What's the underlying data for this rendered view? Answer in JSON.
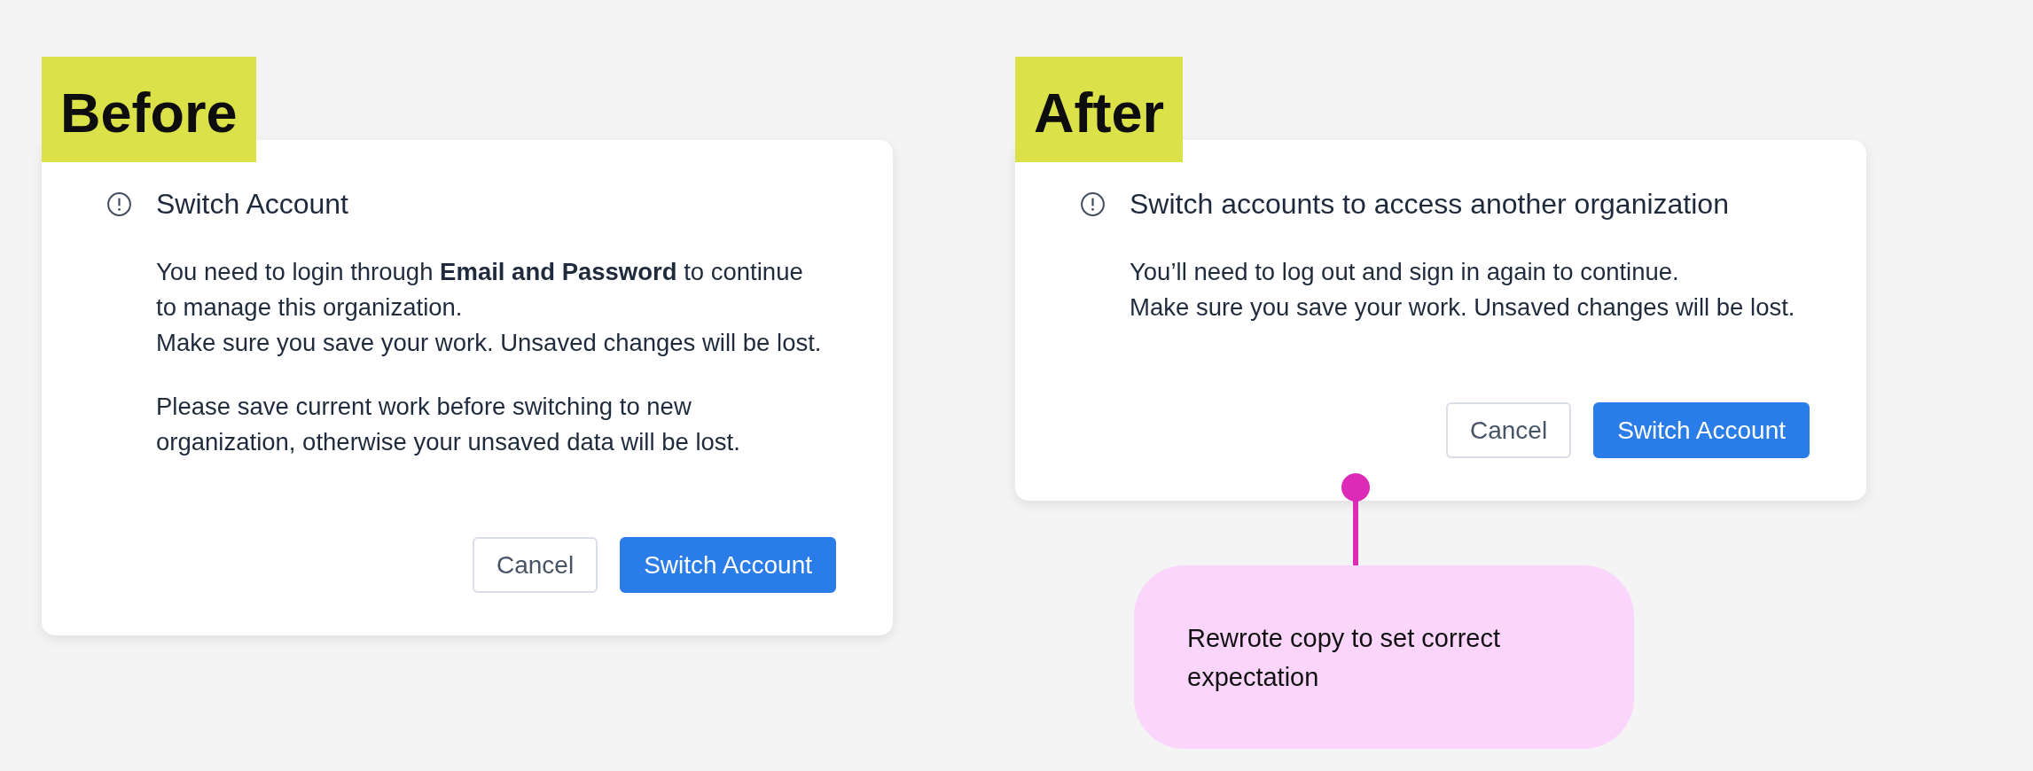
{
  "panels": [
    {
      "label": "Before",
      "dialog": {
        "title": "Switch Account",
        "paragraphs": [
          {
            "lines": [
              "You need to login through **Email and Password** to continue",
              "to manage this organization.",
              "Make sure you save your work. Unsaved changes will be lost."
            ]
          },
          {
            "lines": [
              "Please save current work before switching to new",
              "organization, otherwise your unsaved data will be lost."
            ]
          }
        ],
        "buttons": [
          {
            "label": "Cancel",
            "kind": "secondary"
          },
          {
            "label": "Switch Account",
            "kind": "primary"
          }
        ]
      }
    },
    {
      "label": "After",
      "dialog": {
        "title": "Switch accounts to access another organization",
        "paragraphs": [
          {
            "lines": [
              "You’ll need to log out and sign in again to continue.",
              "Make sure you save your work. Unsaved changes will be lost."
            ]
          }
        ],
        "buttons": [
          {
            "label": "Cancel",
            "kind": "secondary"
          },
          {
            "label": "Switch Account",
            "kind": "primary"
          }
        ]
      },
      "annotation": {
        "text": "Rewrote copy to set correct expectation"
      }
    }
  ]
}
